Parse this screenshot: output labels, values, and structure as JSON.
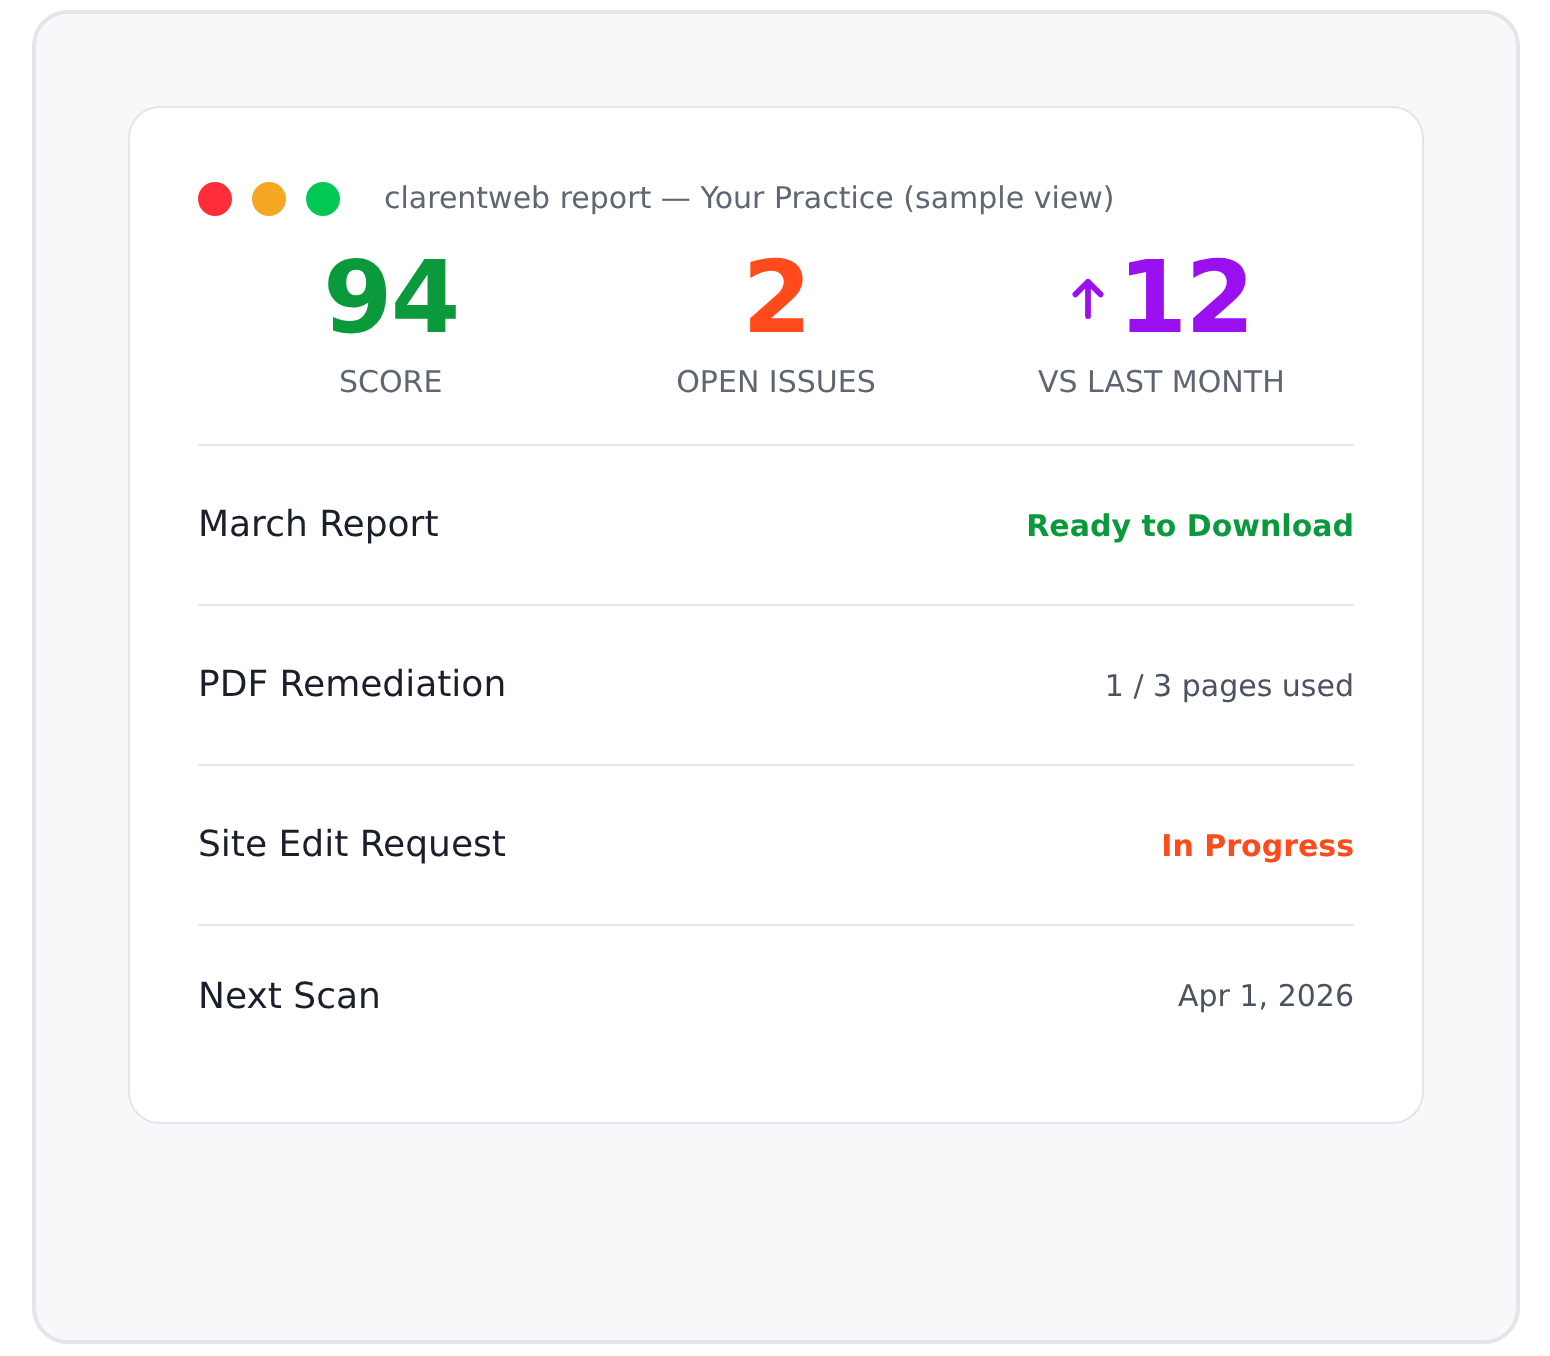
{
  "window": {
    "title": "clarentweb report — Your Practice (sample view)"
  },
  "stats": [
    {
      "kind": "plain",
      "value": "94",
      "label": "SCORE",
      "color": "#0a9a3c"
    },
    {
      "kind": "plain",
      "value": "2",
      "label": "OPEN ISSUES",
      "color": "#ff4a1c"
    },
    {
      "kind": "trend-up",
      "value": "12",
      "label": "VS LAST MONTH",
      "color": "#9b10f0"
    }
  ],
  "rows": [
    {
      "name": "March Report",
      "status": "Ready to Download",
      "color": "#0a9a3c"
    },
    {
      "name": "PDF Remediation",
      "status": "1 / 3 pages used",
      "color": "#4b5260"
    },
    {
      "name": "Site Edit Request",
      "status": "In Progress",
      "color": "#ff4a1c"
    },
    {
      "name": "Next Scan",
      "status": "Apr 1, 2026",
      "color": "#4b5260"
    }
  ]
}
